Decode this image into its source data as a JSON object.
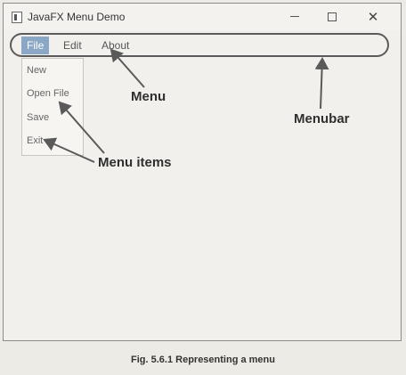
{
  "window": {
    "title": "JavaFX Menu Demo",
    "controls": {
      "minimize": "",
      "maximize": "",
      "close": "✕"
    }
  },
  "menubar": {
    "menus": [
      "File",
      "Edit",
      "About"
    ],
    "active_menu": "File"
  },
  "file_menu": {
    "items": [
      "New",
      "Open File",
      "Save",
      "Exit"
    ]
  },
  "callouts": {
    "menu": "Menu",
    "menubar": "Menubar",
    "menu_items": "Menu items"
  },
  "caption": "Fig. 5.6.1 Representing a menu",
  "colors": {
    "page_background": "#ecebe6",
    "active_menu_background": "#8aa7c6",
    "annotation_line": "#5a5a5a"
  }
}
